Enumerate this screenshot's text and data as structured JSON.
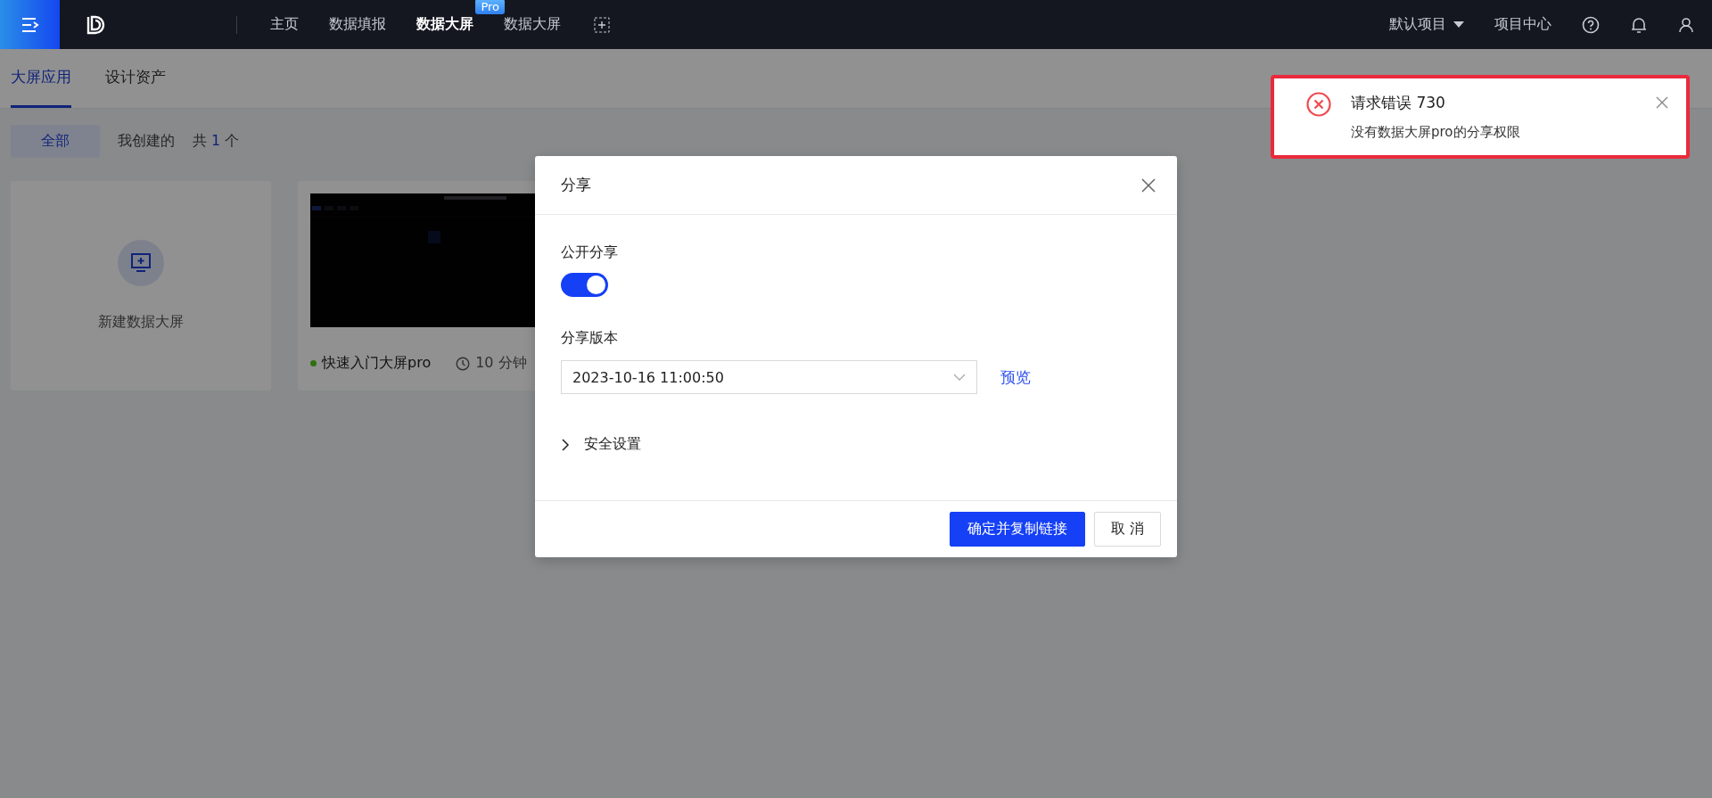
{
  "topbar": {
    "nav": [
      {
        "label": "主页",
        "selected": false
      },
      {
        "label": "数据填报",
        "selected": false
      },
      {
        "label": "数据大屏",
        "selected": true,
        "badge": "Pro"
      },
      {
        "label": "数据大屏",
        "selected": false
      }
    ],
    "project": "默认项目",
    "project_center": "项目中心"
  },
  "subtabs": [
    {
      "label": "大屏应用",
      "selected": true
    },
    {
      "label": "设计资产",
      "selected": false
    }
  ],
  "filters": [
    {
      "label": "全部",
      "selected": true
    },
    {
      "label": "我创建的",
      "selected": false
    }
  ],
  "count": {
    "prefix": "共",
    "value": "1",
    "suffix": "个"
  },
  "new_card": {
    "label": "新建数据大屏"
  },
  "apps": [
    {
      "name": "快速入门大屏pro",
      "color": "#2f700f",
      "time": "10 分钟"
    }
  ],
  "modal": {
    "title": "分享",
    "public_label": "公开分享",
    "public_on": true,
    "version_label": "分享版本",
    "version_value": "2023-10-16 11:00:50",
    "preview": "预览",
    "security": {
      "label": "安全设置",
      "expanded": false
    },
    "confirm": "确定并复制链接",
    "cancel": "取 消"
  },
  "notification": {
    "title": "请求错误 730",
    "message": "没有数据大屏pro的分享权限"
  }
}
